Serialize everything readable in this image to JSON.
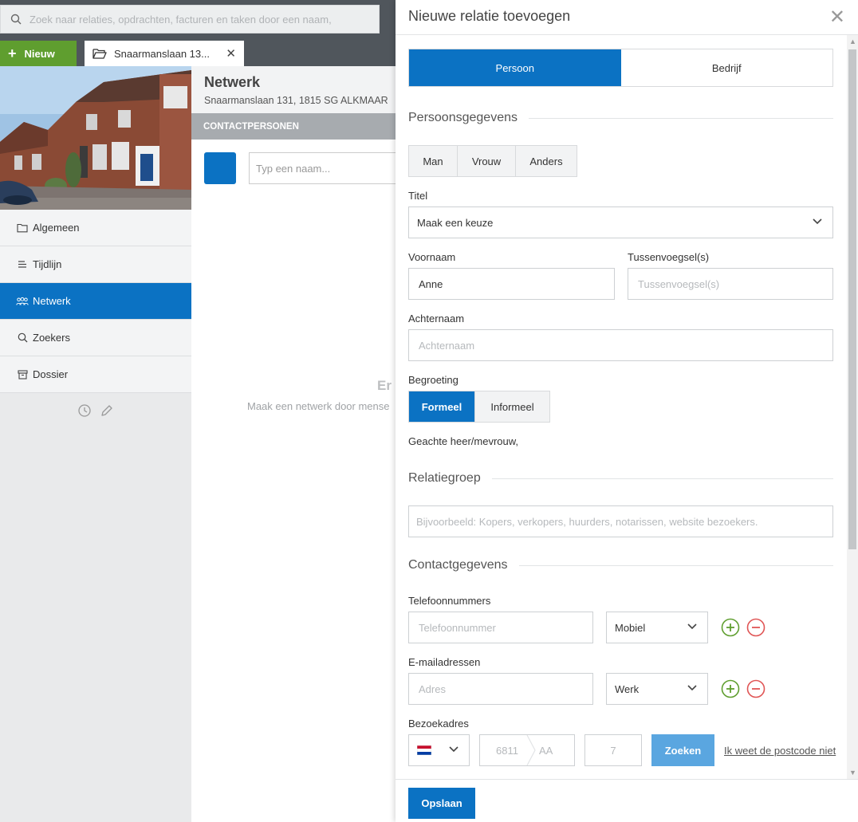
{
  "search": {
    "placeholder": "Zoek naar relaties, opdrachten, facturen en taken door een naam,"
  },
  "toolbar": {
    "new_label": "Nieuw",
    "open_tab_label": "Snaarmanslaan 13..."
  },
  "sidebar": {
    "items": [
      {
        "label": "Algemeen",
        "icon": "folder-icon",
        "active": false
      },
      {
        "label": "Tijdlijn",
        "icon": "list-icon",
        "active": false
      },
      {
        "label": "Netwerk",
        "icon": "people-icon",
        "active": true
      },
      {
        "label": "Zoekers",
        "icon": "search-icon",
        "active": false
      },
      {
        "label": "Dossier",
        "icon": "archive-icon",
        "active": false
      }
    ]
  },
  "content": {
    "title": "Netwerk",
    "address": "Snaarmanslaan 131, 1815 SG ALKMAAR",
    "section_header": "CONTACTPERSONEN",
    "name_placeholder": "Typ een naam...",
    "empty_title": "Er",
    "empty_text": "Maak een netwerk door mense"
  },
  "modal": {
    "title": "Nieuwe relatie toevoegen",
    "type_tabs": [
      "Persoon",
      "Bedrijf"
    ],
    "type_selected": "Persoon",
    "persoonsgegevens": {
      "section_title": "Persoonsgegevens",
      "gender_options": [
        "Man",
        "Vrouw",
        "Anders"
      ],
      "titel_label": "Titel",
      "titel_value": "Maak een keuze",
      "voornaam_label": "Voornaam",
      "voornaam_value": "Anne",
      "tussenvoegsel_label": "Tussenvoegsel(s)",
      "tussenvoegsel_placeholder": "Tussenvoegsel(s)",
      "achternaam_label": "Achternaam",
      "achternaam_placeholder": "Achternaam",
      "begroeting_label": "Begroeting",
      "begroeting_options": [
        "Formeel",
        "Informeel"
      ],
      "begroeting_selected": "Formeel",
      "greeting_text": "Geachte heer/mevrouw,"
    },
    "relatiegroep": {
      "section_title": "Relatiegroep",
      "placeholder": "Bijvoorbeeld: Kopers, verkopers, huurders, notarissen, website bezoekers."
    },
    "contactgegevens": {
      "section_title": "Contactgegevens",
      "telefoon_label": "Telefoonnummers",
      "telefoon_placeholder": "Telefoonnummer",
      "telefoon_type": "Mobiel",
      "email_label": "E-mailadressen",
      "email_placeholder": "Adres",
      "email_type": "Werk",
      "bezoekadres_label": "Bezoekadres",
      "country_flag": "netherlands-flag-icon",
      "postcode_digits_placeholder": "6811",
      "postcode_letters_placeholder": "AA",
      "huisnummer_placeholder": "7",
      "zoeken_label": "Zoeken",
      "postcode_unknown_link": "Ik weet de postcode niet"
    },
    "save_label": "Opslaan"
  },
  "colors": {
    "primary": "#0b72c3",
    "new_button": "#5f9e2f",
    "search_button": "#5aa6e0",
    "add": "#5f9e2f",
    "remove": "#e05555"
  }
}
